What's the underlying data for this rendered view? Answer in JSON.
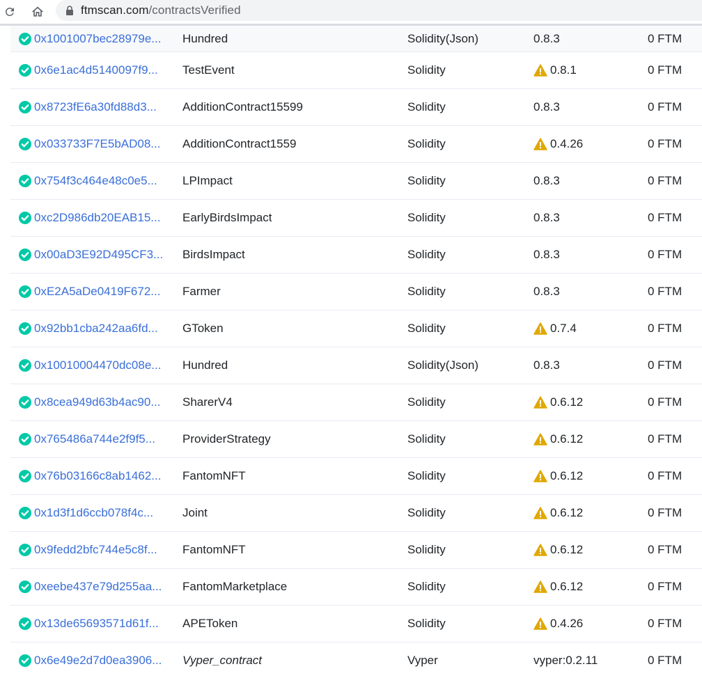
{
  "browser": {
    "url_domain": "ftmscan.com",
    "url_path": "/contractsVerified"
  },
  "colors": {
    "verified": "#00c9a7",
    "link": "#3a6fd8",
    "warning": "#e0a800"
  },
  "contracts": [
    {
      "address": "0x1001007bec28979e...",
      "name": "Hundred",
      "compiler": "Solidity(Json)",
      "version": "0.8.3",
      "warning": false,
      "balance": "0 FTM"
    },
    {
      "address": "0x6e1ac4d5140097f9...",
      "name": "TestEvent",
      "compiler": "Solidity",
      "version": "0.8.1",
      "warning": true,
      "balance": "0 FTM"
    },
    {
      "address": "0x8723fE6a30fd88d3...",
      "name": "AdditionContract15599",
      "compiler": "Solidity",
      "version": "0.8.3",
      "warning": false,
      "balance": "0 FTM"
    },
    {
      "address": "0x033733F7E5bAD08...",
      "name": "AdditionContract1559",
      "compiler": "Solidity",
      "version": "0.4.26",
      "warning": true,
      "balance": "0 FTM"
    },
    {
      "address": "0x754f3c464e48c0e5...",
      "name": "LPImpact",
      "compiler": "Solidity",
      "version": "0.8.3",
      "warning": false,
      "balance": "0 FTM"
    },
    {
      "address": "0xc2D986db20EAB15...",
      "name": "EarlyBirdsImpact",
      "compiler": "Solidity",
      "version": "0.8.3",
      "warning": false,
      "balance": "0 FTM"
    },
    {
      "address": "0x00aD3E92D495CF3...",
      "name": "BirdsImpact",
      "compiler": "Solidity",
      "version": "0.8.3",
      "warning": false,
      "balance": "0 FTM"
    },
    {
      "address": "0xE2A5aDe0419F672...",
      "name": "Farmer",
      "compiler": "Solidity",
      "version": "0.8.3",
      "warning": false,
      "balance": "0 FTM"
    },
    {
      "address": "0x92bb1cba242aa6fd...",
      "name": "GToken",
      "compiler": "Solidity",
      "version": "0.7.4",
      "warning": true,
      "balance": "0 FTM"
    },
    {
      "address": "0x10010004470dc08e...",
      "name": "Hundred",
      "compiler": "Solidity(Json)",
      "version": "0.8.3",
      "warning": false,
      "balance": "0 FTM"
    },
    {
      "address": "0x8cea949d63b4ac90...",
      "name": "SharerV4",
      "compiler": "Solidity",
      "version": "0.6.12",
      "warning": true,
      "balance": "0 FTM"
    },
    {
      "address": "0x765486a744e2f9f5...",
      "name": "ProviderStrategy",
      "compiler": "Solidity",
      "version": "0.6.12",
      "warning": true,
      "balance": "0 FTM"
    },
    {
      "address": "0x76b03166c8ab1462...",
      "name": "FantomNFT",
      "compiler": "Solidity",
      "version": "0.6.12",
      "warning": true,
      "balance": "0 FTM"
    },
    {
      "address": "0x1d3f1d6ccb078f4c...",
      "name": "Joint",
      "compiler": "Solidity",
      "version": "0.6.12",
      "warning": true,
      "balance": "0 FTM"
    },
    {
      "address": "0x9fedd2bfc744e5c8f...",
      "name": "FantomNFT",
      "compiler": "Solidity",
      "version": "0.6.12",
      "warning": true,
      "balance": "0 FTM"
    },
    {
      "address": "0xeebe437e79d255aa...",
      "name": "FantomMarketplace",
      "compiler": "Solidity",
      "version": "0.6.12",
      "warning": true,
      "balance": "0 FTM"
    },
    {
      "address": "0x13de65693571d61f...",
      "name": "APEToken",
      "compiler": "Solidity",
      "version": "0.4.26",
      "warning": true,
      "balance": "0 FTM"
    },
    {
      "address": "0x6e49e2d7d0ea3906...",
      "name": "Vyper_contract",
      "name_italic": true,
      "compiler": "Vyper",
      "version": "vyper:0.2.11",
      "warning": false,
      "balance": "0 FTM"
    }
  ]
}
